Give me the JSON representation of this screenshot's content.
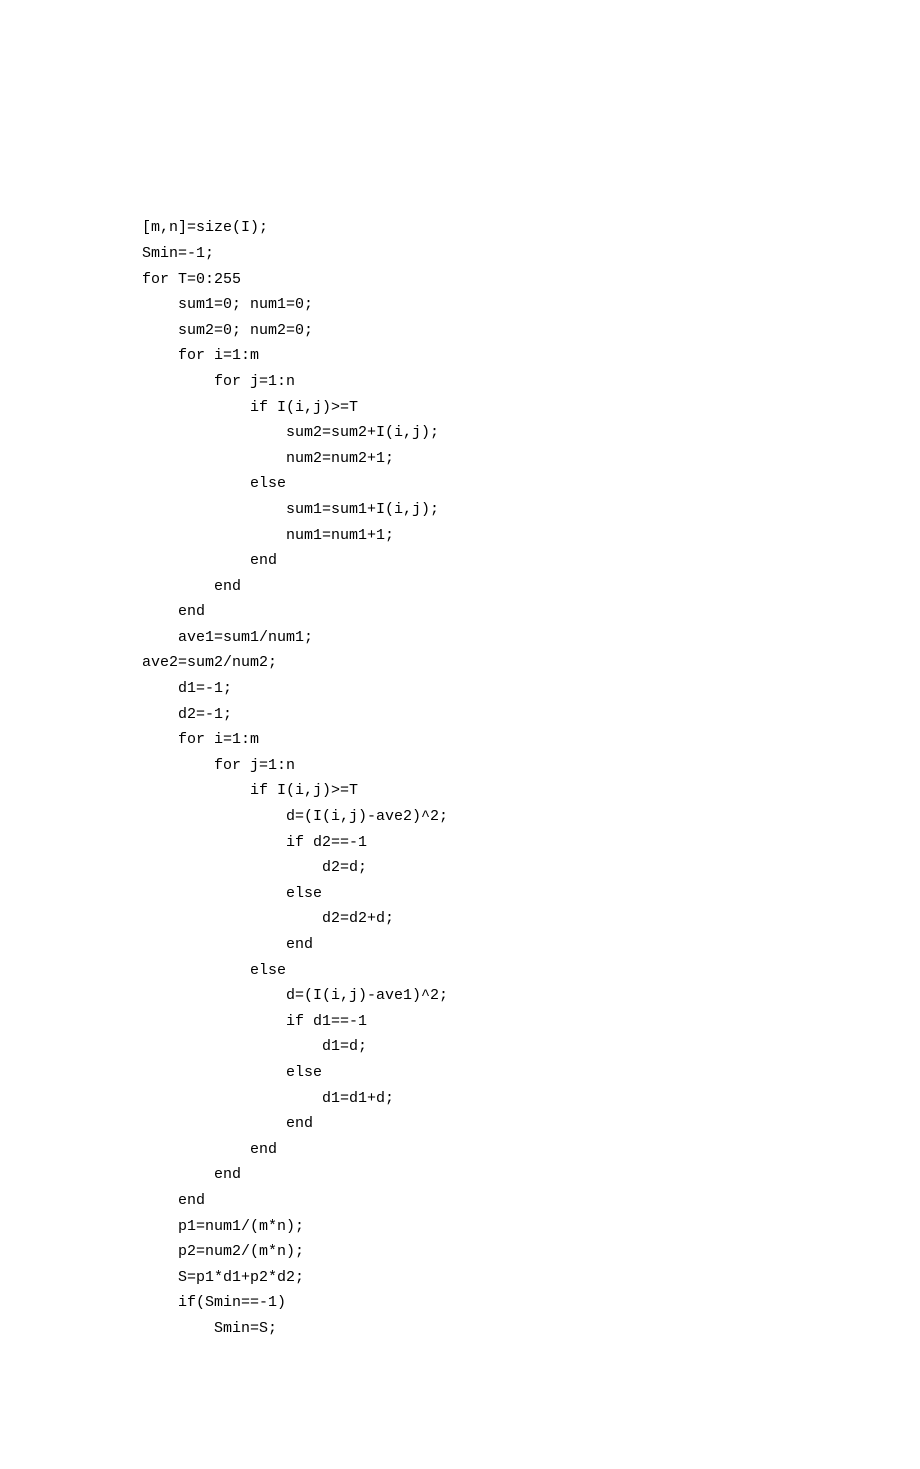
{
  "indent": "    ",
  "lines": [
    {
      "depth": 0,
      "text": "[m,n]=size(I);"
    },
    {
      "depth": 0,
      "text": "Smin=-1;"
    },
    {
      "depth": 0,
      "text": "for T=0:255"
    },
    {
      "depth": 1,
      "text": "sum1=0; num1=0;"
    },
    {
      "depth": 1,
      "text": "sum2=0; num2=0;"
    },
    {
      "depth": 1,
      "text": "for i=1:m"
    },
    {
      "depth": 2,
      "text": "for j=1:n"
    },
    {
      "depth": 3,
      "text": "if I(i,j)>=T"
    },
    {
      "depth": 4,
      "text": "sum2=sum2+I(i,j);"
    },
    {
      "depth": 4,
      "text": "num2=num2+1;"
    },
    {
      "depth": 3,
      "text": "else"
    },
    {
      "depth": 4,
      "text": "sum1=sum1+I(i,j);"
    },
    {
      "depth": 4,
      "text": "num1=num1+1;"
    },
    {
      "depth": 3,
      "text": "end"
    },
    {
      "depth": 2,
      "text": "end"
    },
    {
      "depth": 1,
      "text": "end"
    },
    {
      "depth": 1,
      "text": "ave1=sum1/num1;"
    },
    {
      "depth": 0,
      "text": "ave2=sum2/num2;"
    },
    {
      "depth": 1,
      "text": "d1=-1;"
    },
    {
      "depth": 1,
      "text": "d2=-1;"
    },
    {
      "depth": 1,
      "text": "for i=1:m"
    },
    {
      "depth": 2,
      "text": "for j=1:n"
    },
    {
      "depth": 3,
      "text": "if I(i,j)>=T"
    },
    {
      "depth": 4,
      "text": "d=(I(i,j)-ave2)^2;"
    },
    {
      "depth": 4,
      "text": "if d2==-1"
    },
    {
      "depth": 5,
      "text": "d2=d;"
    },
    {
      "depth": 4,
      "text": "else"
    },
    {
      "depth": 5,
      "text": "d2=d2+d;"
    },
    {
      "depth": 4,
      "text": "end"
    },
    {
      "depth": 3,
      "text": "else"
    },
    {
      "depth": 4,
      "text": "d=(I(i,j)-ave1)^2;"
    },
    {
      "depth": 4,
      "text": "if d1==-1"
    },
    {
      "depth": 5,
      "text": "d1=d;"
    },
    {
      "depth": 4,
      "text": "else"
    },
    {
      "depth": 5,
      "text": "d1=d1+d;"
    },
    {
      "depth": 4,
      "text": "end"
    },
    {
      "depth": 3,
      "text": "end"
    },
    {
      "depth": 2,
      "text": "end"
    },
    {
      "depth": 1,
      "text": "end"
    },
    {
      "depth": 1,
      "text": "p1=num1/(m*n);"
    },
    {
      "depth": 1,
      "text": "p2=num2/(m*n);"
    },
    {
      "depth": 1,
      "text": "S=p1*d1+p2*d2;"
    },
    {
      "depth": 1,
      "text": "if(Smin==-1)"
    },
    {
      "depth": 2,
      "text": "Smin=S;"
    }
  ]
}
